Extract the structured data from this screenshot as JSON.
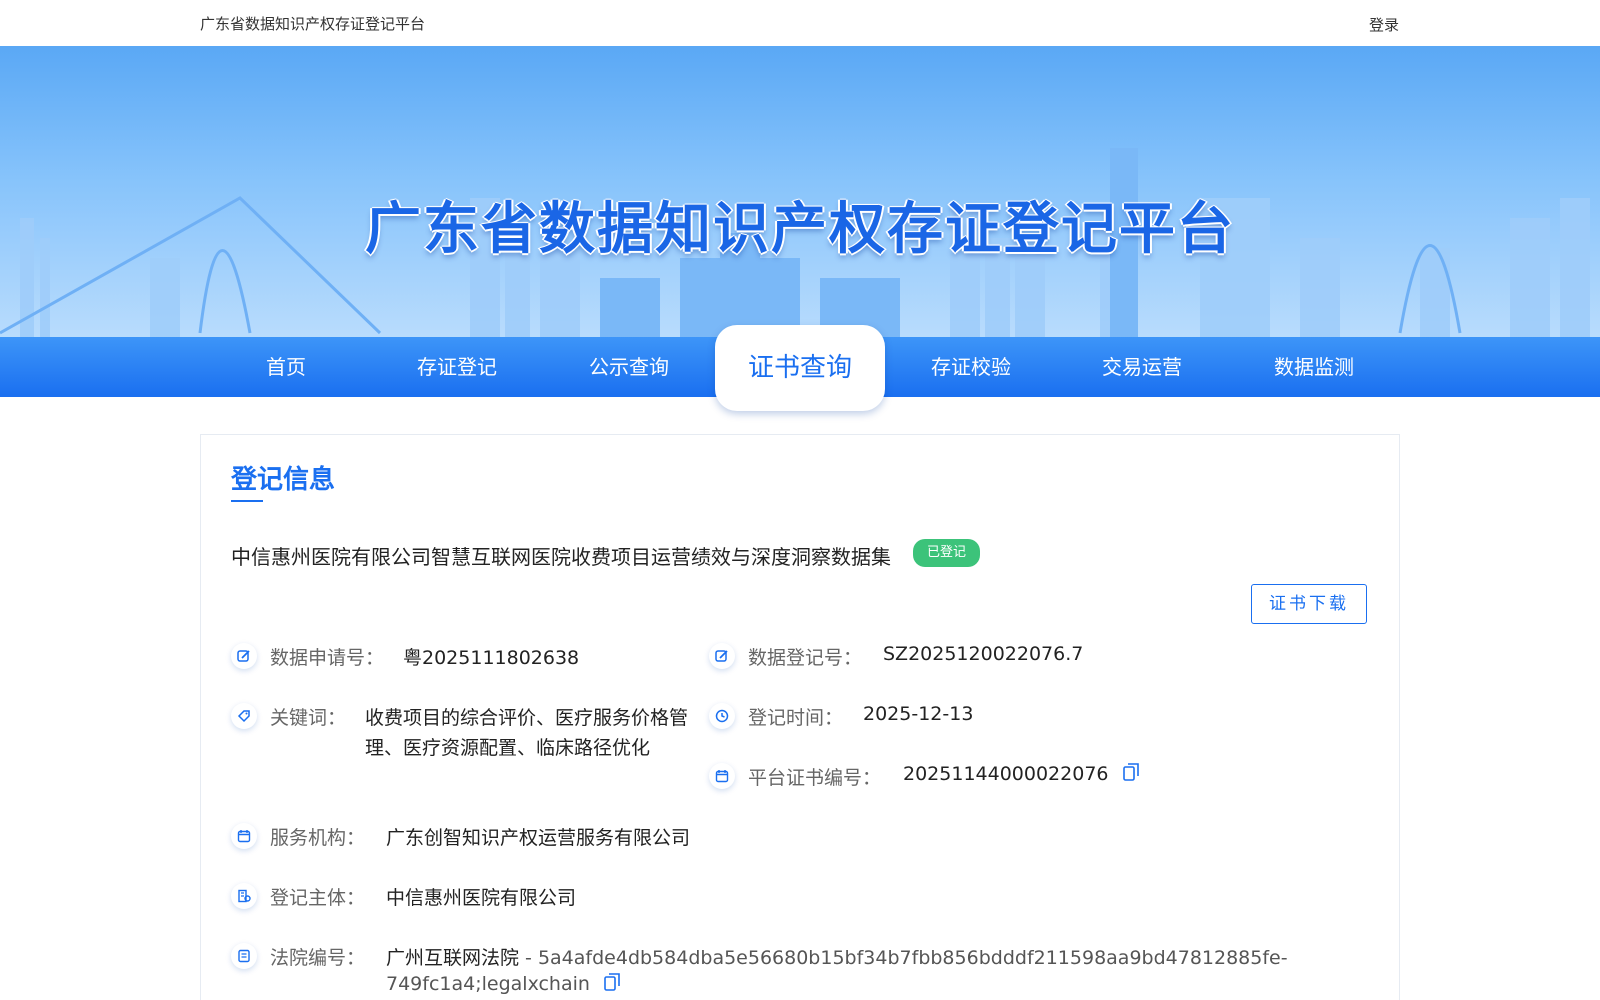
{
  "header": {
    "site_name": "广东省数据知识产权存证登记平台",
    "login": "登录"
  },
  "banner": {
    "title": "广东省数据知识产权存证登记平台"
  },
  "nav": {
    "items": [
      {
        "label": "首页"
      },
      {
        "label": "存证登记"
      },
      {
        "label": "公示查询"
      },
      {
        "label": "证书查询",
        "active": true
      },
      {
        "label": "存证校验"
      },
      {
        "label": "交易运营"
      },
      {
        "label": "数据监测"
      }
    ]
  },
  "record": {
    "section_title": "登记信息",
    "dataset_name": "中信惠州医院有限公司智慧互联网医院收费项目运营绩效与深度洞察数据集",
    "status_badge": "已登记",
    "download_button": "证书下载",
    "fields": {
      "application_no": {
        "label": "数据申请号：",
        "value": "粤2025111802638"
      },
      "registration_no": {
        "label": "数据登记号：",
        "value": "SZ2025120022076.7"
      },
      "keywords": {
        "label": "关键词：",
        "line1": "收费项目的综合评价、医疗服务价格管",
        "line2": "理、医疗资源配置、临床路径优化"
      },
      "registration_time": {
        "label": "登记时间：",
        "value": "2025-12-13"
      },
      "certificate_no": {
        "label": "平台证书编号：",
        "value": "20251144000022076"
      },
      "service_org": {
        "label": "服务机构：",
        "value": "广东创智知识产权运营服务有限公司"
      },
      "subject": {
        "label": "登记主体：",
        "value": "中信惠州医院有限公司"
      },
      "court_no": {
        "label": "法院编号：",
        "court": "广州互联网法院",
        "hash_line1": " - 5a4afde4db584dba5e56680b15bf34b7fbb856bdddf211598aa9bd47812885fe-",
        "hash_line2": "749fc1a4;legalxchain"
      }
    }
  },
  "colors": {
    "primary": "#1a6ff0",
    "badge_green": "#3cc37a"
  }
}
